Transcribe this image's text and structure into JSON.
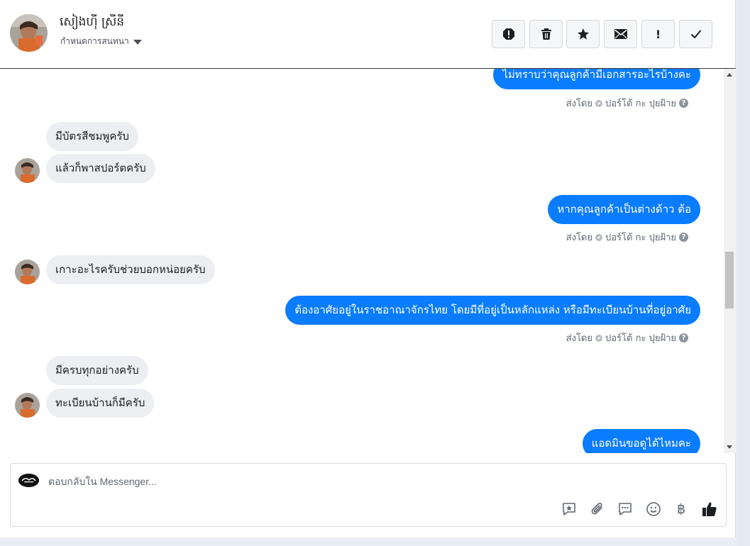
{
  "header": {
    "contact_name": "សៀងហ៊ី ស្រីនី",
    "conversation_settings": "กำหนดการสนทนา",
    "actions": [
      {
        "name": "mark-spam-button",
        "icon": "alert-circle-icon"
      },
      {
        "name": "delete-button",
        "icon": "trash-icon"
      },
      {
        "name": "star-button",
        "icon": "star-icon"
      },
      {
        "name": "mark-unread-button",
        "icon": "envelope-icon"
      },
      {
        "name": "follow-up-button",
        "icon": "exclamation-icon",
        "glyph": "!"
      },
      {
        "name": "mark-done-button",
        "icon": "check-icon"
      }
    ]
  },
  "messages": [
    {
      "dir": "out",
      "text": "ไม่ทราบว่าคุณลูกค้ามีเอกสารอะไรบ้างคะ",
      "meta": {
        "sent_by": "ส่งโดย",
        "sender": "ปอร์โต้ กะ ปุยฝ้าย"
      }
    },
    {
      "dir": "in",
      "text": "มีบัตรสีชมพูครับ"
    },
    {
      "dir": "in",
      "text": "แล้วก็พาสปอร์ตครับ"
    },
    {
      "dir": "out",
      "text": "หากคุณลูกค้าเป็นต่างด้าว ต้อ",
      "meta": {
        "sent_by": "ส่งโดย",
        "sender": "ปอร์โต้ กะ ปุยฝ้าย"
      }
    },
    {
      "dir": "in",
      "text": "เกาะอะไรครับช่วยบอกหน่อยครับ"
    },
    {
      "dir": "out",
      "text": "ต้องอาศัยอยู่ในราชอาณาจักรไทย  โดยมีที่อยู่เป็นหลักแหล่ง หรือมีทะเบียนบ้านที่อยู่อาศัย",
      "meta": {
        "sent_by": "ส่งโดย",
        "sender": "ปอร์โต้ กะ ปุยฝ้าย"
      }
    },
    {
      "dir": "in",
      "text": "มีครบทุกอย่างครับ"
    },
    {
      "dir": "in",
      "text": "ทะเบียนบ้านก็มีครับ"
    },
    {
      "dir": "out",
      "text": "แอดมินขอดูได้ไหมคะ"
    }
  ],
  "composer": {
    "placeholder": "ตอบกลับใน Messenger...",
    "tools": [
      "saved-reply-icon",
      "attachment-icon",
      "chat-bubble-icon",
      "emoji-icon",
      "baht-icon",
      "like-icon"
    ],
    "baht_glyph": "฿"
  },
  "colors": {
    "outgoing_bubble": "#0a7cff",
    "incoming_bubble": "#eceef1"
  }
}
